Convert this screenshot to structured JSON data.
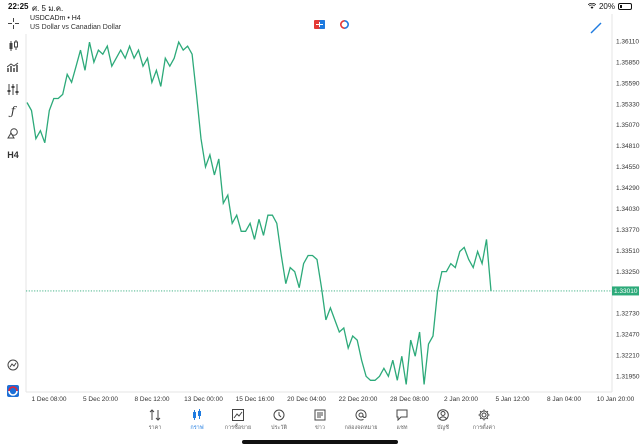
{
  "status_bar": {
    "time": "22:25",
    "date": "ศ. 5 ม.ค.",
    "battery": "20%",
    "battery_level": 0.2
  },
  "symbol": {
    "title": "USDCADm • H4",
    "description": "US Dollar vs Canadian Dollar"
  },
  "left_toolbar": [
    "crosshair-icon",
    "candles-icon",
    "indicators-icon",
    "sliders-icon",
    "function-icon",
    "shapes-icon",
    "timeframe-h4"
  ],
  "left_toolbar_h4": "H4",
  "chart_data": {
    "type": "line",
    "color": "#2daa7a",
    "current_price": "1.33010",
    "current_price_value": 1.3301,
    "ylim": [
      1.3178,
      1.3625
    ],
    "y_ticks": [
      "1.36110",
      "1.35850",
      "1.35590",
      "1.35330",
      "1.35070",
      "1.34810",
      "1.34550",
      "1.34290",
      "1.34030",
      "1.33770",
      "1.33510",
      "1.33250",
      "1.33010",
      "1.32730",
      "1.32470",
      "1.32210",
      "1.31950"
    ],
    "x_ticks": [
      "1 Dec 08:00",
      "5 Dec 20:00",
      "8 Dec 12:00",
      "13 Dec 00:00",
      "15 Dec 16:00",
      "20 Dec 04:00",
      "22 Dec 20:00",
      "28 Dec 08:00",
      "2 Jan 20:00",
      "5 Jan 12:00",
      "8 Jan 04:00",
      "10 Jan 20:00"
    ],
    "series": [
      {
        "values": [
          1.3535,
          1.3525,
          1.349,
          1.35,
          1.3485,
          1.3525,
          1.354,
          1.354,
          1.3545,
          1.357,
          1.356,
          1.358,
          1.36,
          1.3575,
          1.361,
          1.3585,
          1.36,
          1.3595,
          1.3605,
          1.358,
          1.359,
          1.36,
          1.359,
          1.3605,
          1.359,
          1.36,
          1.358,
          1.359,
          1.356,
          1.3575,
          1.3555,
          1.359,
          1.358,
          1.359,
          1.361,
          1.36,
          1.3605,
          1.3595,
          1.3545,
          1.349,
          1.3455,
          1.347,
          1.3445,
          1.3465,
          1.341,
          1.342,
          1.3385,
          1.3395,
          1.3375,
          1.3375,
          1.3385,
          1.3365,
          1.339,
          1.337,
          1.3395,
          1.3395,
          1.3385,
          1.3345,
          1.331,
          1.333,
          1.3325,
          1.3305,
          1.3335,
          1.3345,
          1.3345,
          1.334,
          1.3305,
          1.3265,
          1.328,
          1.3265,
          1.325,
          1.3255,
          1.323,
          1.3245,
          1.324,
          1.3215,
          1.3195,
          1.319,
          1.319,
          1.3195,
          1.3205,
          1.3195,
          1.3215,
          1.319,
          1.322,
          1.3185,
          1.324,
          1.322,
          1.325,
          1.3185,
          1.3235,
          1.3245,
          1.33,
          1.3325,
          1.3325,
          1.3335,
          1.333,
          1.335,
          1.3355,
          1.334,
          1.333,
          1.335,
          1.3335,
          1.3365,
          1.3301
        ]
      }
    ]
  },
  "tabs": [
    {
      "label": "ราคา",
      "icon": "sort-arrows-icon"
    },
    {
      "label": "กราฟ",
      "icon": "chart-candles-icon"
    },
    {
      "label": "การซื้อขาย",
      "icon": "trade-chart-icon"
    },
    {
      "label": "ประวัติ",
      "icon": "history-icon"
    },
    {
      "label": "ข่าว",
      "icon": "news-icon"
    },
    {
      "label": "กล่องจดหมาย",
      "icon": "at-mailbox-icon"
    },
    {
      "label": "แชท",
      "icon": "chat-icon"
    },
    {
      "label": "บัญชี",
      "icon": "account-icon"
    },
    {
      "label": "การตั้งค่า",
      "icon": "settings-gear-icon"
    }
  ],
  "active_tab": 1,
  "colors": {
    "line": "#2daa7a",
    "price_tag": "#2daa7a",
    "active": "#1e7be0",
    "axis_text": "#333333"
  }
}
